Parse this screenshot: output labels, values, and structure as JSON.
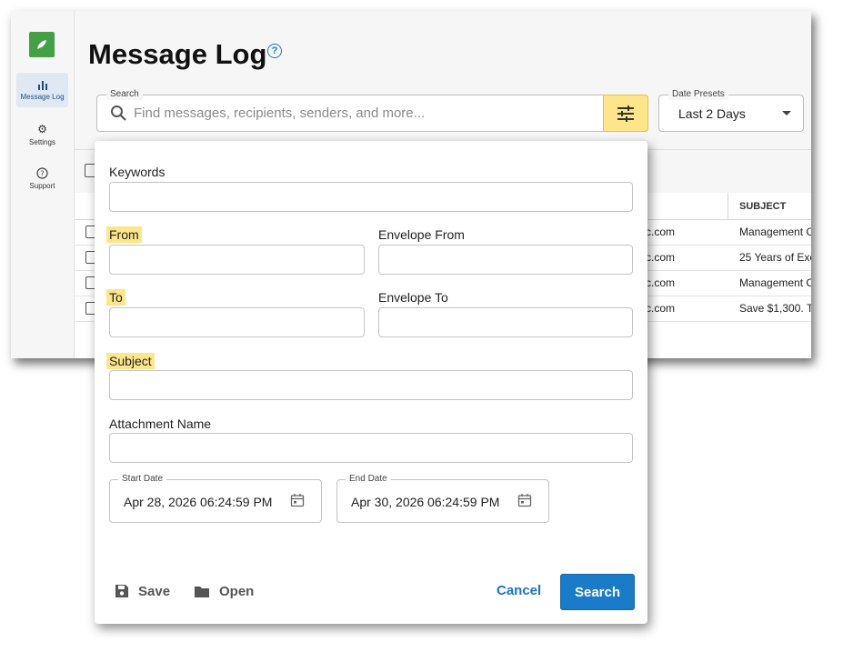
{
  "sidebar": {
    "items": [
      {
        "label": "Message Log",
        "icon": "bar-chart-icon"
      },
      {
        "label": "Settings",
        "icon": "gear-icon"
      },
      {
        "label": "Support",
        "icon": "help-circle-icon"
      }
    ]
  },
  "header": {
    "title": "Message Log"
  },
  "search": {
    "label": "Search",
    "placeholder": "Find messages, recipients, senders, and more..."
  },
  "date_presets": {
    "label": "Date Presets",
    "value": "Last 2 Days"
  },
  "table": {
    "columns": [
      "SUBJECT"
    ],
    "rows": [
      {
        "recipient": "c.com",
        "subject": "Management C"
      },
      {
        "recipient": "c.com",
        "subject": "25 Years of Exc"
      },
      {
        "recipient": "c.com",
        "subject": "Management C"
      },
      {
        "recipient": "c.com",
        "subject": "Save $1,300. T"
      }
    ]
  },
  "advanced_search": {
    "keywords_label": "Keywords",
    "from_label": "From",
    "envelope_from_label": "Envelope From",
    "to_label": "To",
    "envelope_to_label": "Envelope To",
    "subject_label": "Subject",
    "attachment_label": "Attachment Name",
    "start_date": {
      "label": "Start Date",
      "value": "Apr 28, 2026 06:24:59 PM"
    },
    "end_date": {
      "label": "End Date",
      "value": "Apr 30, 2026 06:24:59 PM"
    },
    "save_label": "Save",
    "open_label": "Open",
    "cancel_label": "Cancel",
    "search_label": "Search"
  },
  "colors": {
    "highlight": "#fde68a",
    "primary": "#1a7bc9",
    "brand_green": "#43a047"
  }
}
